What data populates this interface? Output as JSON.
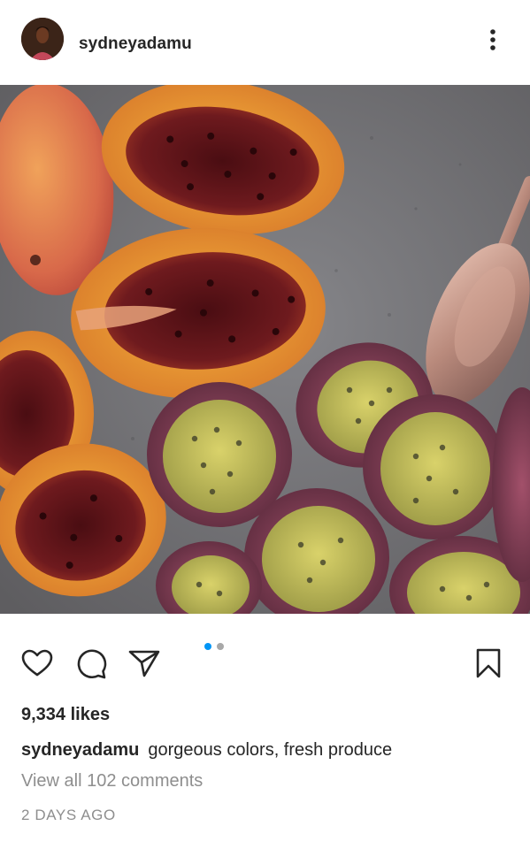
{
  "post": {
    "username": "sydneyadamu",
    "likes": "9,334 likes",
    "caption_user": "sydneyadamu",
    "caption_text": "gorgeous colors, fresh produce",
    "view_comments": "View all 102 comments",
    "timestamp": "2 DAYS AGO"
  },
  "carousel": {
    "total": 2,
    "active_index": 0
  },
  "icons": {
    "more": "more-options-icon",
    "like": "heart-icon",
    "comment": "comment-icon",
    "share": "send-icon",
    "save": "bookmark-icon"
  },
  "colors": {
    "text": "#262626",
    "muted": "#8e8e8e",
    "active_dot": "#0095f6",
    "inactive_dot": "#a8a8a8"
  }
}
